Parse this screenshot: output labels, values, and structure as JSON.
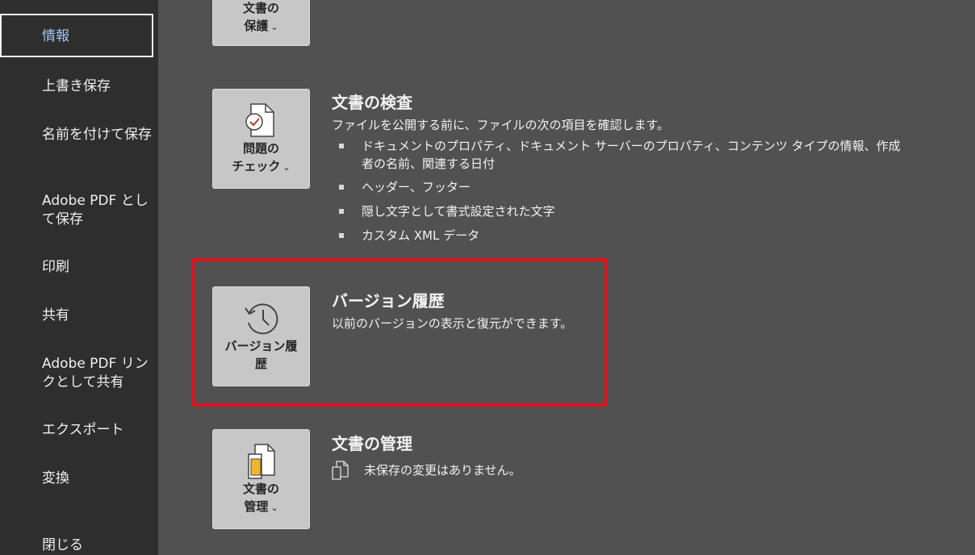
{
  "sidebar": {
    "items": [
      {
        "label": "情報",
        "selected": true
      },
      {
        "label": "上書き保存"
      },
      {
        "label": "名前を付けて保存"
      },
      {
        "label": "Adobe PDF として保存"
      },
      {
        "label": "印刷"
      },
      {
        "label": "共有"
      },
      {
        "label": "Adobe PDF リンクとして共有"
      },
      {
        "label": "エクスポート"
      },
      {
        "label": "変換"
      },
      {
        "label": "閉じる"
      }
    ]
  },
  "main": {
    "protect": {
      "button_line1": "文書の",
      "button_line2": "保護",
      "icon": "lock-document-icon"
    },
    "inspect": {
      "button_line1": "問題の",
      "button_line2": "チェック",
      "icon": "document-check-icon",
      "title": "文書の検査",
      "description": "ファイルを公開する前に、ファイルの次の項目を確認します。",
      "bullets": [
        "ドキュメントのプロパティ、ドキュメント サーバーのプロパティ、コンテンツ タイプの情報、作成者の名前、関連する日付",
        "ヘッダー、フッター",
        "隠し文字として書式設定された文字",
        "カスタム XML データ"
      ]
    },
    "version_history": {
      "button_line1": "バージョン履",
      "button_line2": "歴",
      "icon": "history-clock-icon",
      "title": "バージョン履歴",
      "description": "以前のバージョンの表示と復元ができます。"
    },
    "manage": {
      "button_line1": "文書の",
      "button_line2": "管理",
      "icon": "manage-document-icon",
      "title": "文書の管理",
      "status_icon": "document-status-icon",
      "status": "未保存の変更はありません。"
    }
  },
  "colors": {
    "sidebar_bg": "#2e2e2e",
    "main_bg": "#515151",
    "button_bg": "#c7c7c7",
    "highlight": "#e2121c",
    "selected_text": "#9fc6f2"
  }
}
